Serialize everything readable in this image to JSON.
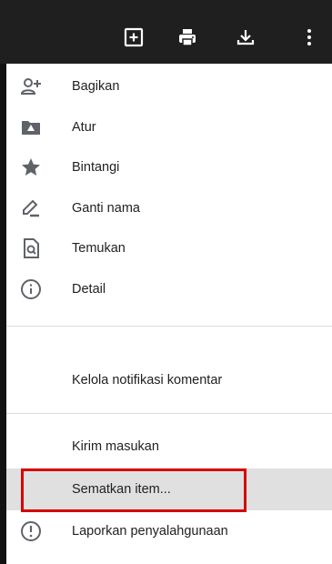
{
  "toolbar": {
    "icons": [
      "add-comment-icon",
      "print-icon",
      "download-icon",
      "more-vert-icon"
    ]
  },
  "menu": {
    "items": [
      {
        "label": "Bagikan",
        "icon": "share-person-add-icon"
      },
      {
        "label": "Atur",
        "icon": "move-folder-icon"
      },
      {
        "label": "Bintangi",
        "icon": "star-icon"
      },
      {
        "label": "Ganti nama",
        "icon": "rename-pencil-icon"
      },
      {
        "label": "Temukan",
        "icon": "find-in-page-icon"
      },
      {
        "label": "Detail",
        "icon": "info-icon"
      },
      {
        "label": "Kelola notifikasi komentar"
      },
      {
        "label": "Kirim masukan"
      },
      {
        "label": "Sematkan item..."
      },
      {
        "label": "Laporkan penyalahgunaan",
        "icon": "report-icon"
      }
    ],
    "highlighted_item": "Sematkan item..."
  },
  "colors": {
    "toolbar_bg": "#1f1f1f",
    "highlight_bg": "#e0e0e0",
    "annotation_red": "#d50000"
  }
}
